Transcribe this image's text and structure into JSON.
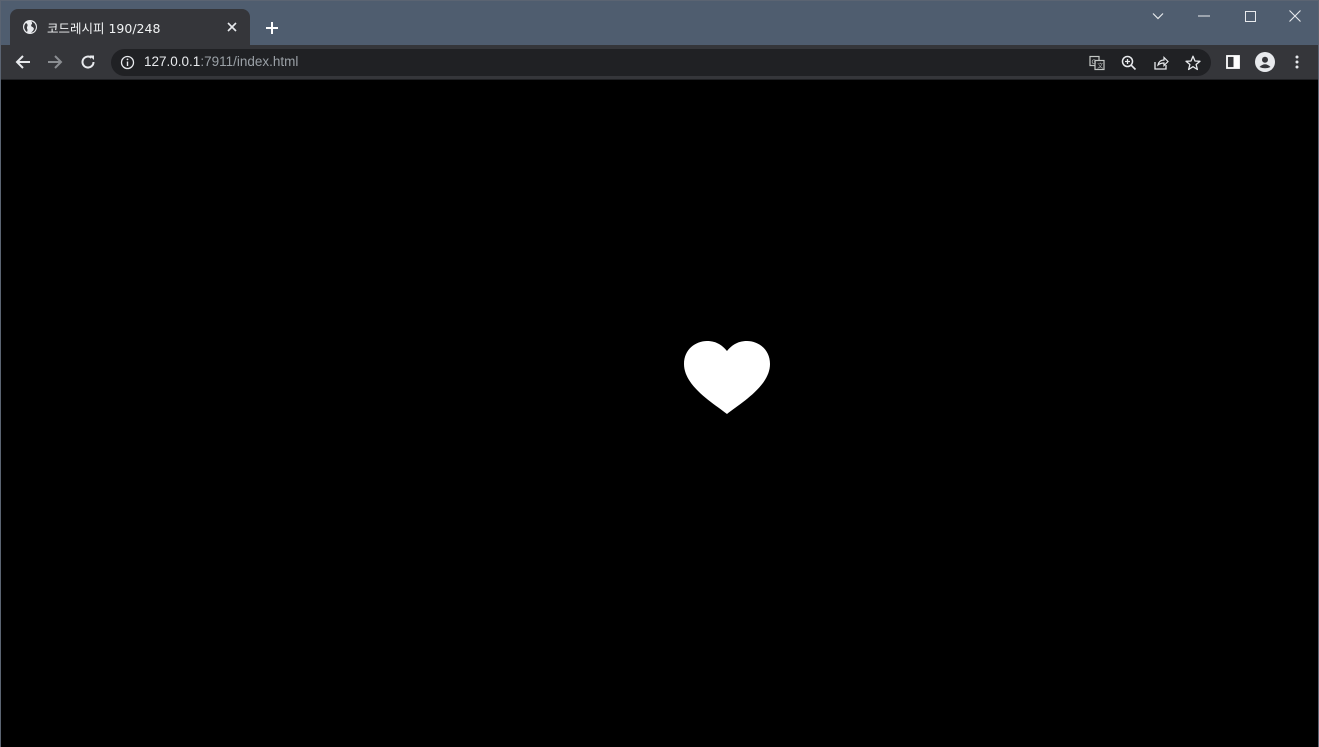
{
  "tab": {
    "title": "코드레시피 190/248",
    "favicon": "globe-icon",
    "close_icon": "close-icon"
  },
  "window_controls": [
    "chevron-down-icon",
    "minimize-icon",
    "maximize-icon",
    "close-icon"
  ],
  "toolbar": {
    "back_icon": "arrow-left-icon",
    "forward_icon": "arrow-right-icon",
    "reload_icon": "reload-icon",
    "address": {
      "host": "127.0.0.1",
      "rest": ":7911/index.html",
      "info_icon": "info-icon"
    },
    "omnibox_icons": [
      "translate-icon",
      "zoom-icon",
      "share-icon",
      "star-icon"
    ],
    "right_icons": [
      "side-panel-icon",
      "profile-icon",
      "more-icon"
    ]
  },
  "page": {
    "background": "#000000",
    "heart_color": "#ffffff",
    "content_icon": "heart-icon"
  },
  "colors": {
    "tabstrip": "#4f5d6f",
    "toolbar": "#35363a",
    "omnibox": "#202124"
  }
}
